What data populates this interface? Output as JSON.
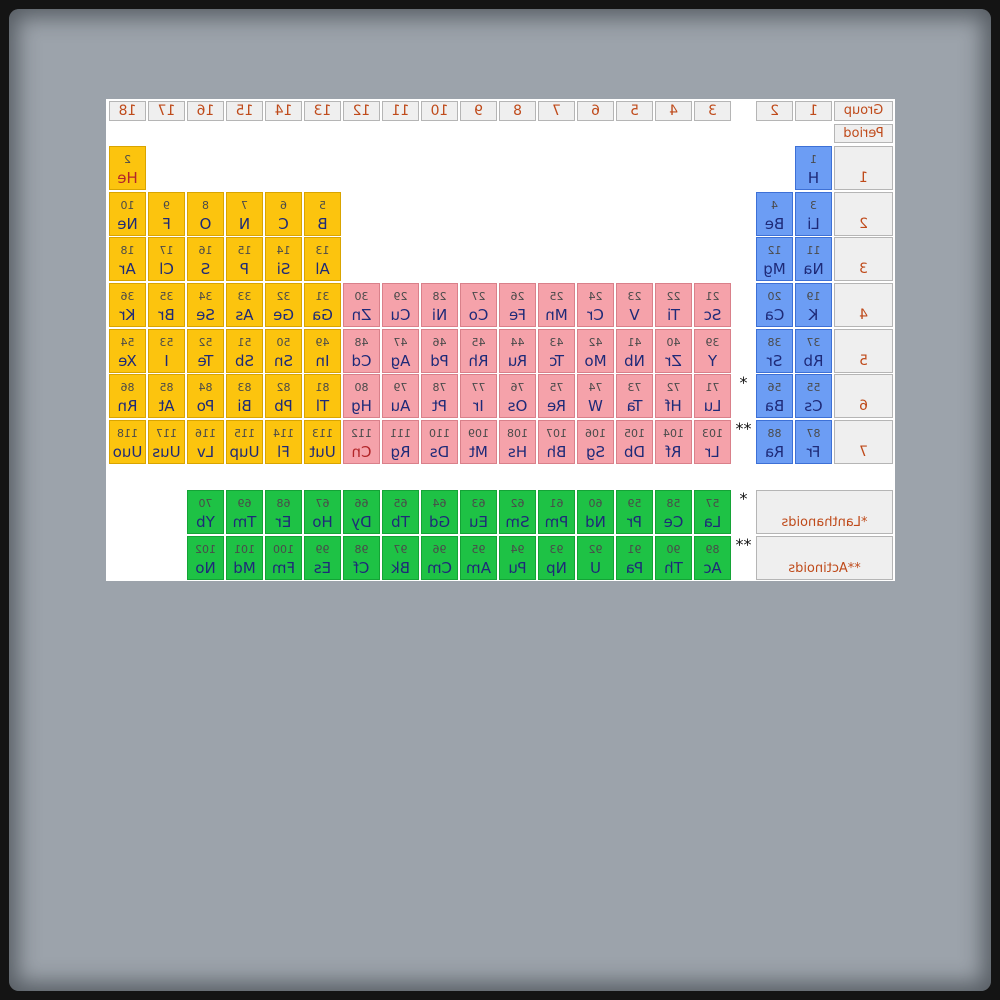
{
  "colors": {
    "s_block": "#6c9df4",
    "p_block": "#fcc40e",
    "d_block": "#f5a2aa",
    "f_block": "#1ec245",
    "header_text": "#bf4a1a",
    "highlight_symbol": "#b3262a"
  },
  "header": {
    "group_label": "Group",
    "period_label": "Period",
    "groups": [
      "1",
      "2",
      "3",
      "4",
      "5",
      "6",
      "7",
      "8",
      "9",
      "10",
      "11",
      "12",
      "13",
      "14",
      "15",
      "16",
      "17",
      "18"
    ]
  },
  "periods": [
    {
      "label": "1",
      "marker": "",
      "s_block": [
        {
          "number": "1",
          "symbol": "H"
        }
      ],
      "d_block": [],
      "p_block": [
        {
          "number": "2",
          "symbol": "He",
          "symbol_color": "#b3262a"
        }
      ]
    },
    {
      "label": "2",
      "marker": "",
      "s_block": [
        {
          "number": "3",
          "symbol": "Li"
        },
        {
          "number": "4",
          "symbol": "Be"
        }
      ],
      "d_block": [],
      "p_block": [
        {
          "number": "5",
          "symbol": "B"
        },
        {
          "number": "6",
          "symbol": "C"
        },
        {
          "number": "7",
          "symbol": "N"
        },
        {
          "number": "8",
          "symbol": "O"
        },
        {
          "number": "9",
          "symbol": "F"
        },
        {
          "number": "10",
          "symbol": "Ne"
        }
      ]
    },
    {
      "label": "3",
      "marker": "",
      "s_block": [
        {
          "number": "11",
          "symbol": "Na"
        },
        {
          "number": "12",
          "symbol": "Mg"
        }
      ],
      "d_block": [],
      "p_block": [
        {
          "number": "13",
          "symbol": "Al"
        },
        {
          "number": "14",
          "symbol": "Si"
        },
        {
          "number": "15",
          "symbol": "P"
        },
        {
          "number": "16",
          "symbol": "S"
        },
        {
          "number": "17",
          "symbol": "Cl"
        },
        {
          "number": "18",
          "symbol": "Ar"
        }
      ]
    },
    {
      "label": "4",
      "marker": "",
      "s_block": [
        {
          "number": "19",
          "symbol": "K"
        },
        {
          "number": "20",
          "symbol": "Ca"
        }
      ],
      "d_block": [
        {
          "number": "21",
          "symbol": "Sc"
        },
        {
          "number": "22",
          "symbol": "Ti"
        },
        {
          "number": "23",
          "symbol": "V"
        },
        {
          "number": "24",
          "symbol": "Cr"
        },
        {
          "number": "25",
          "symbol": "Mn"
        },
        {
          "number": "26",
          "symbol": "Fe"
        },
        {
          "number": "27",
          "symbol": "Co"
        },
        {
          "number": "28",
          "symbol": "Ni"
        },
        {
          "number": "29",
          "symbol": "Cu"
        },
        {
          "number": "30",
          "symbol": "Zn"
        }
      ],
      "p_block": [
        {
          "number": "31",
          "symbol": "Ga"
        },
        {
          "number": "32",
          "symbol": "Ge"
        },
        {
          "number": "33",
          "symbol": "As"
        },
        {
          "number": "34",
          "symbol": "Se"
        },
        {
          "number": "35",
          "symbol": "Br"
        },
        {
          "number": "36",
          "symbol": "Kr"
        }
      ]
    },
    {
      "label": "5",
      "marker": "",
      "s_block": [
        {
          "number": "37",
          "symbol": "Rb"
        },
        {
          "number": "38",
          "symbol": "Sr"
        }
      ],
      "d_block": [
        {
          "number": "39",
          "symbol": "Y"
        },
        {
          "number": "40",
          "symbol": "Zr"
        },
        {
          "number": "41",
          "symbol": "Nb"
        },
        {
          "number": "42",
          "symbol": "Mo"
        },
        {
          "number": "43",
          "symbol": "Tc"
        },
        {
          "number": "44",
          "symbol": "Ru"
        },
        {
          "number": "45",
          "symbol": "Rh"
        },
        {
          "number": "46",
          "symbol": "Pd"
        },
        {
          "number": "47",
          "symbol": "Ag"
        },
        {
          "number": "48",
          "symbol": "Cd"
        }
      ],
      "p_block": [
        {
          "number": "49",
          "symbol": "In"
        },
        {
          "number": "50",
          "symbol": "Sn"
        },
        {
          "number": "51",
          "symbol": "Sb"
        },
        {
          "number": "52",
          "symbol": "Te"
        },
        {
          "number": "53",
          "symbol": "I"
        },
        {
          "number": "54",
          "symbol": "Xe"
        }
      ]
    },
    {
      "label": "6",
      "marker": "*",
      "s_block": [
        {
          "number": "55",
          "symbol": "Cs"
        },
        {
          "number": "56",
          "symbol": "Ba"
        }
      ],
      "d_block": [
        {
          "number": "71",
          "symbol": "Lu"
        },
        {
          "number": "72",
          "symbol": "Hf"
        },
        {
          "number": "73",
          "symbol": "Ta"
        },
        {
          "number": "74",
          "symbol": "W"
        },
        {
          "number": "75",
          "symbol": "Re"
        },
        {
          "number": "76",
          "symbol": "Os"
        },
        {
          "number": "77",
          "symbol": "Ir"
        },
        {
          "number": "78",
          "symbol": "Pt"
        },
        {
          "number": "79",
          "symbol": "Au"
        },
        {
          "number": "80",
          "symbol": "Hg"
        }
      ],
      "p_block": [
        {
          "number": "81",
          "symbol": "Tl"
        },
        {
          "number": "82",
          "symbol": "Pb"
        },
        {
          "number": "83",
          "symbol": "Bi"
        },
        {
          "number": "84",
          "symbol": "Po"
        },
        {
          "number": "85",
          "symbol": "At"
        },
        {
          "number": "86",
          "symbol": "Rn"
        }
      ]
    },
    {
      "label": "7",
      "marker": "**",
      "s_block": [
        {
          "number": "87",
          "symbol": "Fr"
        },
        {
          "number": "88",
          "symbol": "Ra"
        }
      ],
      "d_block": [
        {
          "number": "103",
          "symbol": "Lr"
        },
        {
          "number": "104",
          "symbol": "Rf"
        },
        {
          "number": "105",
          "symbol": "Db"
        },
        {
          "number": "106",
          "symbol": "Sg"
        },
        {
          "number": "107",
          "symbol": "Bh"
        },
        {
          "number": "108",
          "symbol": "Hs"
        },
        {
          "number": "109",
          "symbol": "Mt"
        },
        {
          "number": "110",
          "symbol": "Ds"
        },
        {
          "number": "111",
          "symbol": "Rg"
        },
        {
          "number": "112",
          "symbol": "Cn",
          "symbol_color": "#b3262a"
        }
      ],
      "p_block": [
        {
          "number": "113",
          "symbol": "Uut"
        },
        {
          "number": "114",
          "symbol": "Fl"
        },
        {
          "number": "115",
          "symbol": "Uup"
        },
        {
          "number": "116",
          "symbol": "Lv"
        },
        {
          "number": "117",
          "symbol": "Uus"
        },
        {
          "number": "118",
          "symbol": "Uuo"
        }
      ]
    }
  ],
  "series": [
    {
      "label": "*Lanthanoids",
      "marker": "*",
      "elements": [
        {
          "number": "57",
          "symbol": "La"
        },
        {
          "number": "58",
          "symbol": "Ce"
        },
        {
          "number": "59",
          "symbol": "Pr"
        },
        {
          "number": "60",
          "symbol": "Nd"
        },
        {
          "number": "61",
          "symbol": "Pm"
        },
        {
          "number": "62",
          "symbol": "Sm"
        },
        {
          "number": "63",
          "symbol": "Eu"
        },
        {
          "number": "64",
          "symbol": "Gd"
        },
        {
          "number": "65",
          "symbol": "Tb"
        },
        {
          "number": "66",
          "symbol": "Dy"
        },
        {
          "number": "67",
          "symbol": "Ho"
        },
        {
          "number": "68",
          "symbol": "Er"
        },
        {
          "number": "69",
          "symbol": "Tm"
        },
        {
          "number": "70",
          "symbol": "Yb"
        }
      ]
    },
    {
      "label": "**Actinoids",
      "marker": "**",
      "elements": [
        {
          "number": "89",
          "symbol": "Ac"
        },
        {
          "number": "90",
          "symbol": "Th"
        },
        {
          "number": "91",
          "symbol": "Pa"
        },
        {
          "number": "92",
          "symbol": "U"
        },
        {
          "number": "93",
          "symbol": "Np"
        },
        {
          "number": "94",
          "symbol": "Pu"
        },
        {
          "number": "95",
          "symbol": "Am"
        },
        {
          "number": "96",
          "symbol": "Cm"
        },
        {
          "number": "97",
          "symbol": "Bk"
        },
        {
          "number": "98",
          "symbol": "Cf"
        },
        {
          "number": "99",
          "symbol": "Es"
        },
        {
          "number": "100",
          "symbol": "Fm"
        },
        {
          "number": "101",
          "symbol": "Md"
        },
        {
          "number": "102",
          "symbol": "No"
        }
      ]
    }
  ]
}
